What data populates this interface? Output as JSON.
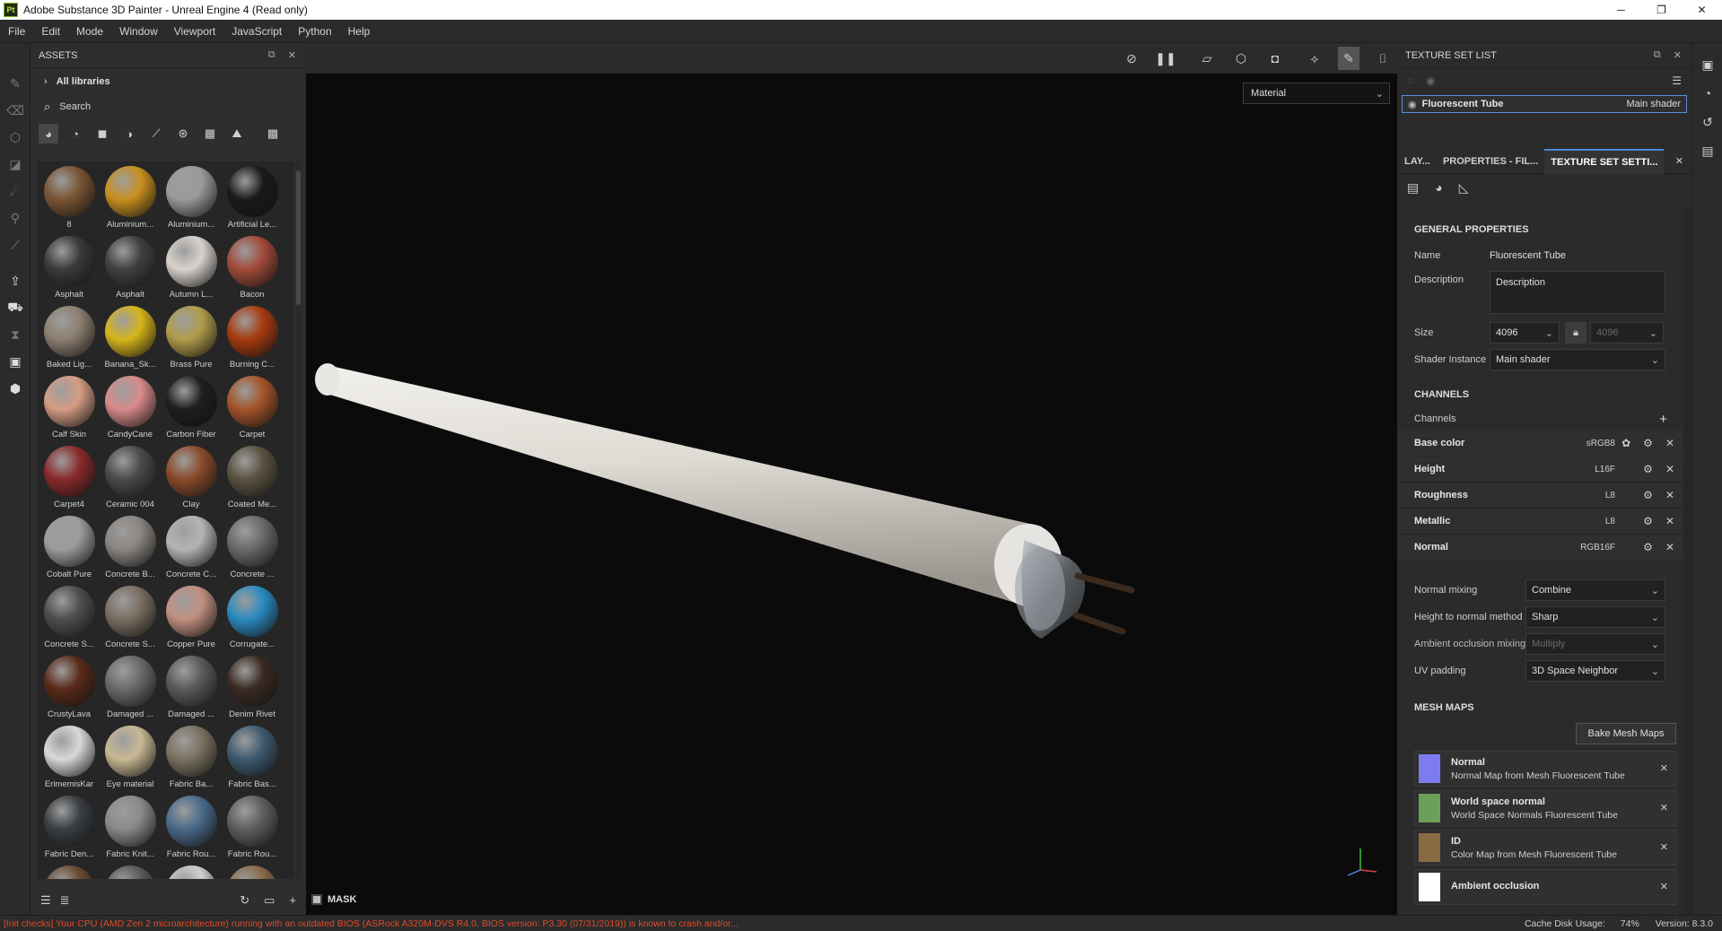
{
  "window": {
    "app_icon": "Pt",
    "title": "Adobe Substance 3D Painter - Unreal Engine 4 (Read only)",
    "controls": [
      "─",
      "❐",
      "✕"
    ]
  },
  "menu": [
    "File",
    "Edit",
    "Mode",
    "Window",
    "Viewport",
    "JavaScript",
    "Python",
    "Help"
  ],
  "assets": {
    "title": "ASSETS",
    "libraries": "All libraries",
    "search": "Search",
    "items": [
      {
        "label": "8",
        "color": "#7a5434"
      },
      {
        "label": "Aluminium...",
        "color": "#c8901e"
      },
      {
        "label": "Aluminium...",
        "color": "#9a9a9a"
      },
      {
        "label": "Artificial Le...",
        "color": "#1a1a1a"
      },
      {
        "label": "Asphalt",
        "color": "#3a3a3a"
      },
      {
        "label": "Asphalt",
        "color": "#404040"
      },
      {
        "label": "Autumn L...",
        "color": "#d9d2cc"
      },
      {
        "label": "Bacon",
        "color": "#a24a3a"
      },
      {
        "label": "Baked Lig...",
        "color": "#8c7f70"
      },
      {
        "label": "Banana_Sk...",
        "color": "#d6b51a"
      },
      {
        "label": "Brass Pure",
        "color": "#b19c4a"
      },
      {
        "label": "Burning C...",
        "color": "#a83a10"
      },
      {
        "label": "Calf Skin",
        "color": "#d49c84"
      },
      {
        "label": "CandyCane",
        "color": "#d88a8a"
      },
      {
        "label": "Carbon Fiber",
        "color": "#1e1e1e"
      },
      {
        "label": "Carpet",
        "color": "#a4542a"
      },
      {
        "label": "Carpet4",
        "color": "#8a2a2a"
      },
      {
        "label": "Ceramic 004",
        "color": "#4a4a4a"
      },
      {
        "label": "Clay",
        "color": "#8a4a2a"
      },
      {
        "label": "Coated Me...",
        "color": "#5a5240"
      },
      {
        "label": "Cobalt Pure",
        "color": "#9c9c9c"
      },
      {
        "label": "Concrete B...",
        "color": "#8a8580"
      },
      {
        "label": "Concrete C...",
        "color": "#b4b4b4"
      },
      {
        "label": "Concrete ...",
        "color": "#6a6a6a"
      },
      {
        "label": "Concrete S...",
        "color": "#4e4e4e"
      },
      {
        "label": "Concrete S...",
        "color": "#7a6e62"
      },
      {
        "label": "Copper Pure",
        "color": "#c09080"
      },
      {
        "label": "Corrugate...",
        "color": "#2a8ac0"
      },
      {
        "label": "CrustyLava",
        "color": "#5a2a18"
      },
      {
        "label": "Damaged ...",
        "color": "#6a6a6a"
      },
      {
        "label": "Damaged ...",
        "color": "#5a5a5a"
      },
      {
        "label": "Denim Rivet",
        "color": "#3a2a22"
      },
      {
        "label": "ErimemisKar",
        "color": "#d8d8d8"
      },
      {
        "label": "Eye material",
        "color": "#c8b894"
      },
      {
        "label": "Fabric Ba...",
        "color": "#7a7260"
      },
      {
        "label": "Fabric Bas...",
        "color": "#3e5a6e"
      },
      {
        "label": "Fabric Den...",
        "color": "#3a3e42"
      },
      {
        "label": "Fabric Knit...",
        "color": "#8a8a8a"
      },
      {
        "label": "Fabric Rou...",
        "color": "#4a6a8a"
      },
      {
        "label": "Fabric Rou...",
        "color": "#5e5e5e"
      },
      {
        "label": "",
        "color": "#6a4a30"
      },
      {
        "label": "",
        "color": "#5a5a5a"
      },
      {
        "label": "",
        "color": "#cfcfcf"
      },
      {
        "label": "",
        "color": "#8a6a4a"
      }
    ]
  },
  "viewport": {
    "display_select": "Material",
    "mask_label": "MASK"
  },
  "texture_set_list": {
    "title": "TEXTURE SET LIST",
    "set_name": "Fluorescent Tube",
    "shader": "Main shader"
  },
  "tabs": {
    "tab1": "LAY...",
    "tab2": "PROPERTIES - FIL...",
    "tab3": "TEXTURE SET SETTI..."
  },
  "general": {
    "title": "GENERAL PROPERTIES",
    "name_label": "Name",
    "name_value": "Fluorescent Tube",
    "desc_label": "Description",
    "desc_value": "Description",
    "size_label": "Size",
    "size_value": "4096",
    "size_value2": "4096",
    "shader_label": "Shader Instance",
    "shader_value": "Main shader"
  },
  "channels": {
    "title": "CHANNELS",
    "label": "Channels",
    "items": [
      {
        "name": "Base color",
        "format": "sRGB8"
      },
      {
        "name": "Height",
        "format": "L16F"
      },
      {
        "name": "Roughness",
        "format": "L8"
      },
      {
        "name": "Metallic",
        "format": "L8"
      },
      {
        "name": "Normal",
        "format": "RGB16F"
      }
    ],
    "normal_mixing_label": "Normal mixing",
    "normal_mixing_value": "Combine",
    "h2n_label": "Height to normal method",
    "h2n_value": "Sharp",
    "ao_label": "Ambient occlusion mixing",
    "ao_value": "Multiply",
    "uv_label": "UV padding",
    "uv_value": "3D Space Neighbor"
  },
  "mesh_maps": {
    "title": "MESH MAPS",
    "bake_button": "Bake Mesh Maps",
    "items": [
      {
        "name": "Normal",
        "desc": "Normal Map from Mesh Fluorescent Tube",
        "color": "#7c7cf0"
      },
      {
        "name": "World space normal",
        "desc": "World Space Normals Fluorescent Tube",
        "color": "#6aa05a"
      },
      {
        "name": "ID",
        "desc": "Color Map from Mesh Fluorescent Tube",
        "color": "#8a6a40"
      },
      {
        "name": "Ambient occlusion",
        "desc": "",
        "color": "#ffffff"
      }
    ]
  },
  "status": {
    "error": "[Init checks] Your CPU (AMD Zen 2 microarchitecture) running with an outdated BIOS (ASRock A320M-DVS R4.0, BIOS version: P3.30 (07/31/2019)) is known to crash and/or...",
    "cache": "Cache Disk Usage:",
    "cache_pct": "74%",
    "version": "Version: 8.3.0"
  }
}
